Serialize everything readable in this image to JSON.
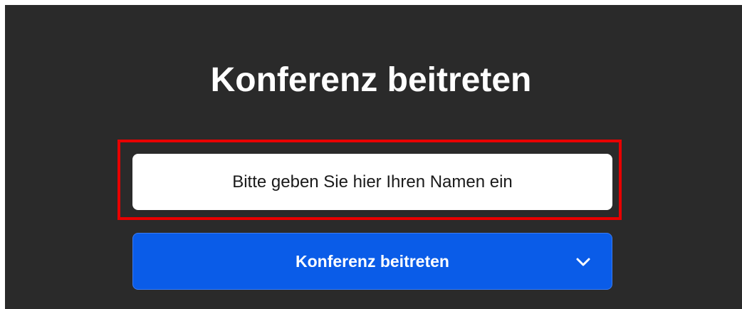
{
  "join": {
    "title": "Konferenz beitreten",
    "name_placeholder": "Bitte geben Sie hier Ihren Namen ein",
    "name_value": "",
    "button_label": "Konferenz beitreten",
    "button_menu_icon": "chevron-down-icon"
  },
  "colors": {
    "background": "#2a2a2a",
    "button": "#0a5ce8",
    "highlight": "#e80000"
  }
}
